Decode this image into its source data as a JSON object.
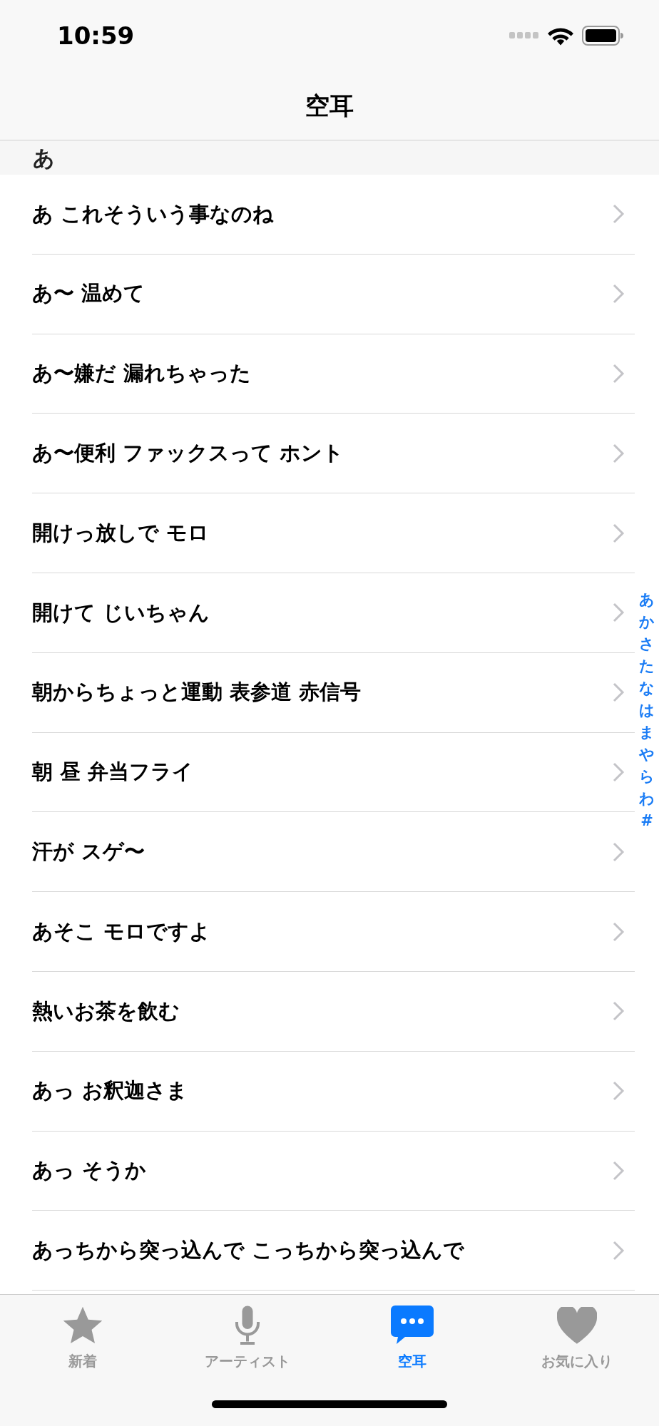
{
  "status_bar": {
    "time": "10:59"
  },
  "nav": {
    "title": "空耳"
  },
  "section": {
    "header": "あ"
  },
  "rows": [
    {
      "title": "あ これそういう事なのね"
    },
    {
      "title": "あ〜 温めて"
    },
    {
      "title": "あ〜嫌だ 漏れちゃった"
    },
    {
      "title": "あ〜便利 ファックスって ホント"
    },
    {
      "title": "開けっ放しで モロ"
    },
    {
      "title": "開けて じいちゃん"
    },
    {
      "title": "朝からちょっと運動 表参道 赤信号"
    },
    {
      "title": "朝 昼 弁当フライ"
    },
    {
      "title": "汗が スゲ〜"
    },
    {
      "title": "あそこ モロですよ"
    },
    {
      "title": "熱いお茶を飲む"
    },
    {
      "title": "あっ お釈迦さま"
    },
    {
      "title": "あっ そうか"
    },
    {
      "title": "あっちから突っ込んで こっちから突っ込んで"
    }
  ],
  "index": [
    "あ",
    "か",
    "さ",
    "た",
    "な",
    "は",
    "ま",
    "や",
    "ら",
    "わ",
    "#"
  ],
  "tabs": [
    {
      "label": "新着",
      "kind": "star",
      "selected": false
    },
    {
      "label": "アーティスト",
      "kind": "mic",
      "selected": false
    },
    {
      "label": "空耳",
      "kind": "chat",
      "selected": true
    },
    {
      "label": "お気に入り",
      "kind": "heart",
      "selected": false
    }
  ]
}
